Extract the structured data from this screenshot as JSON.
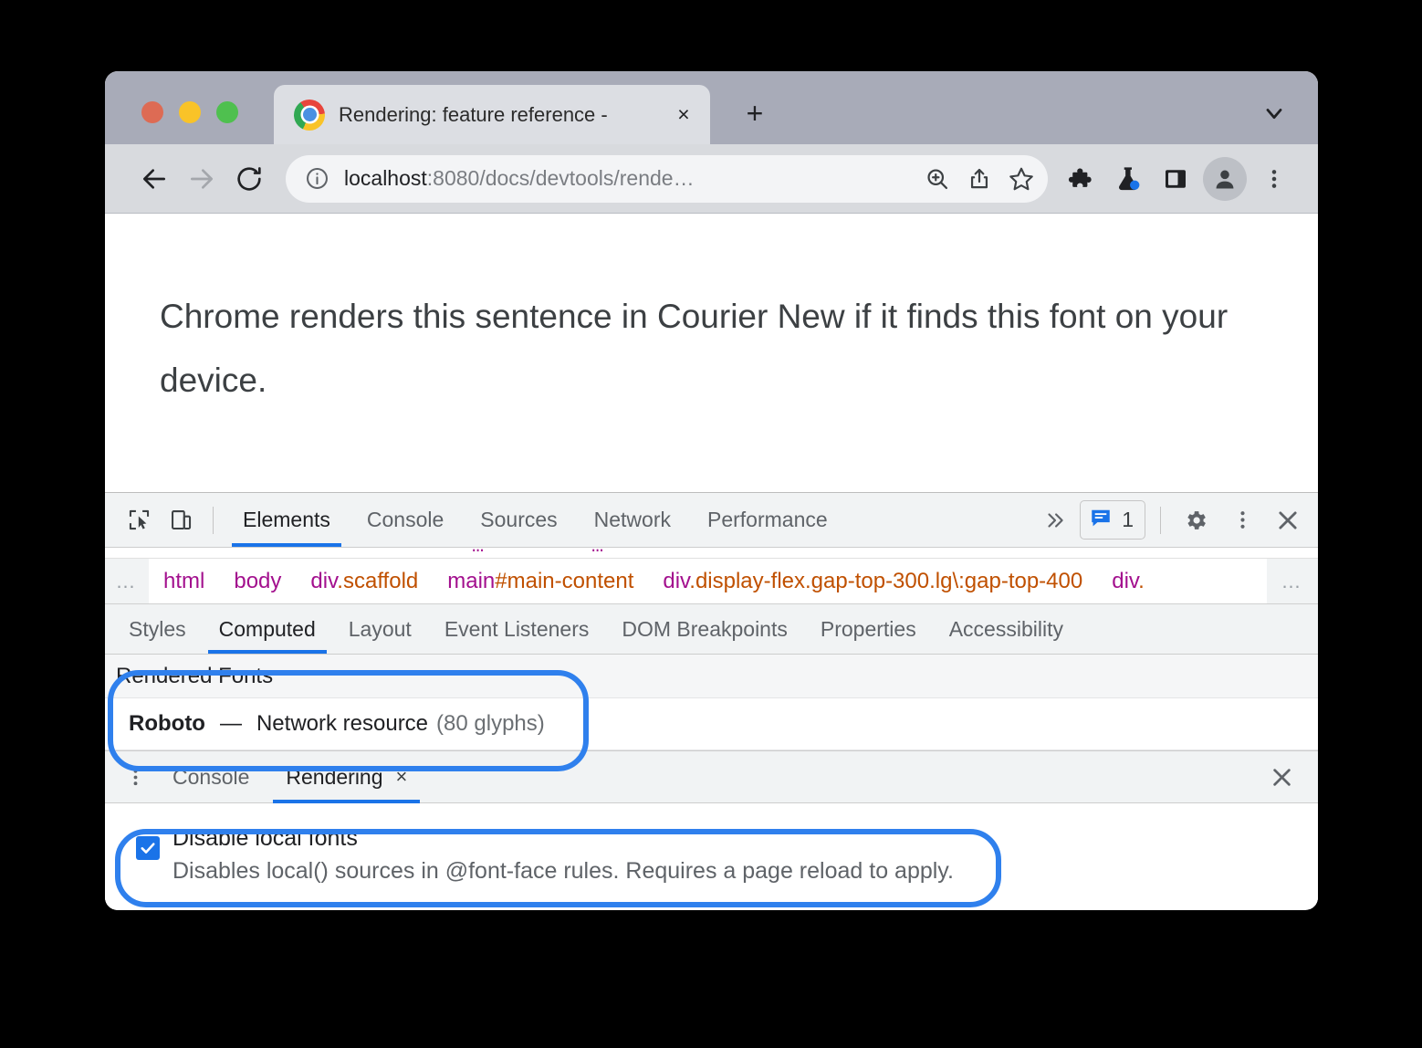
{
  "browser": {
    "tab": {
      "title": "Rendering: feature reference -",
      "favicon": "chrome-logo-icon",
      "close_label": "×"
    },
    "new_tab_label": "+",
    "tab_list_icon": "chevron-down-icon",
    "toolbar": {
      "back_icon": "back-arrow-icon",
      "forward_icon": "forward-arrow-icon",
      "reload_icon": "reload-icon",
      "site_info_icon": "info-circle-icon",
      "url_host": "localhost",
      "url_path": ":8080/docs/devtools/rende…",
      "zoom_icon": "zoom-in-icon",
      "share_icon": "share-icon",
      "bookmark_icon": "star-icon",
      "extensions_icon": "puzzle-piece-icon",
      "labs_icon": "flask-icon",
      "side_panel_icon": "side-panel-icon",
      "profile_icon": "avatar-icon",
      "menu_icon": "three-dots-vertical-icon"
    }
  },
  "page": {
    "sentence": "Chrome renders this sentence in Courier New if it finds this font on your device."
  },
  "devtools": {
    "inspect_icon": "inspect-cursor-icon",
    "device_toolbar_icon": "device-toggle-icon",
    "panels": [
      {
        "label": "Elements",
        "active": true
      },
      {
        "label": "Console",
        "active": false
      },
      {
        "label": "Sources",
        "active": false
      },
      {
        "label": "Network",
        "active": false
      },
      {
        "label": "Performance",
        "active": false
      }
    ],
    "more_panels_icon": "chevron-double-right-icon",
    "issues": {
      "icon": "issues-message-icon",
      "count": "1"
    },
    "settings_icon": "gear-icon",
    "main_menu_icon": "three-dots-vertical-icon",
    "close_icon": "close-x-icon",
    "dom_cut_fragments": [
      "…",
      "…"
    ],
    "breadcrumb": {
      "left_ellipsis": "…",
      "right_ellipsis": "…",
      "items": [
        {
          "tag": "html",
          "cls": ""
        },
        {
          "tag": "body",
          "cls": ""
        },
        {
          "tag": "div",
          "cls": ".scaffold"
        },
        {
          "tag": "main",
          "cls": "#main-content"
        },
        {
          "tag": "div",
          "cls": ".display-flex.gap-top-300.lg\\:gap-top-400"
        },
        {
          "tag": "div",
          "cls": "."
        }
      ]
    },
    "sidebar_tabs": [
      {
        "label": "Styles",
        "active": false
      },
      {
        "label": "Computed",
        "active": true
      },
      {
        "label": "Layout",
        "active": false
      },
      {
        "label": "Event Listeners",
        "active": false
      },
      {
        "label": "DOM Breakpoints",
        "active": false
      },
      {
        "label": "Properties",
        "active": false
      },
      {
        "label": "Accessibility",
        "active": false
      }
    ],
    "computed": {
      "rendered_fonts_header": "Rendered Fonts",
      "font_name": "Roboto",
      "font_dash": "—",
      "font_source": "Network resource",
      "font_glyphs": "(80 glyphs)"
    },
    "drawer": {
      "more_icon": "three-dots-vertical-icon",
      "tabs": [
        {
          "label": "Console",
          "active": false,
          "closable": false
        },
        {
          "label": "Rendering",
          "active": true,
          "closable": true,
          "close_label": "×"
        }
      ],
      "close_icon": "close-x-icon",
      "settings": {
        "disable_local_fonts": {
          "title": "Disable local fonts",
          "description": "Disables local() sources in @font-face rules. Requires a page reload to apply.",
          "checked": true
        }
      }
    }
  },
  "annotations": {
    "highlight_color": "#2f80ed",
    "rings": [
      "rendered-fonts-highlight",
      "disable-local-fonts-highlight"
    ]
  }
}
